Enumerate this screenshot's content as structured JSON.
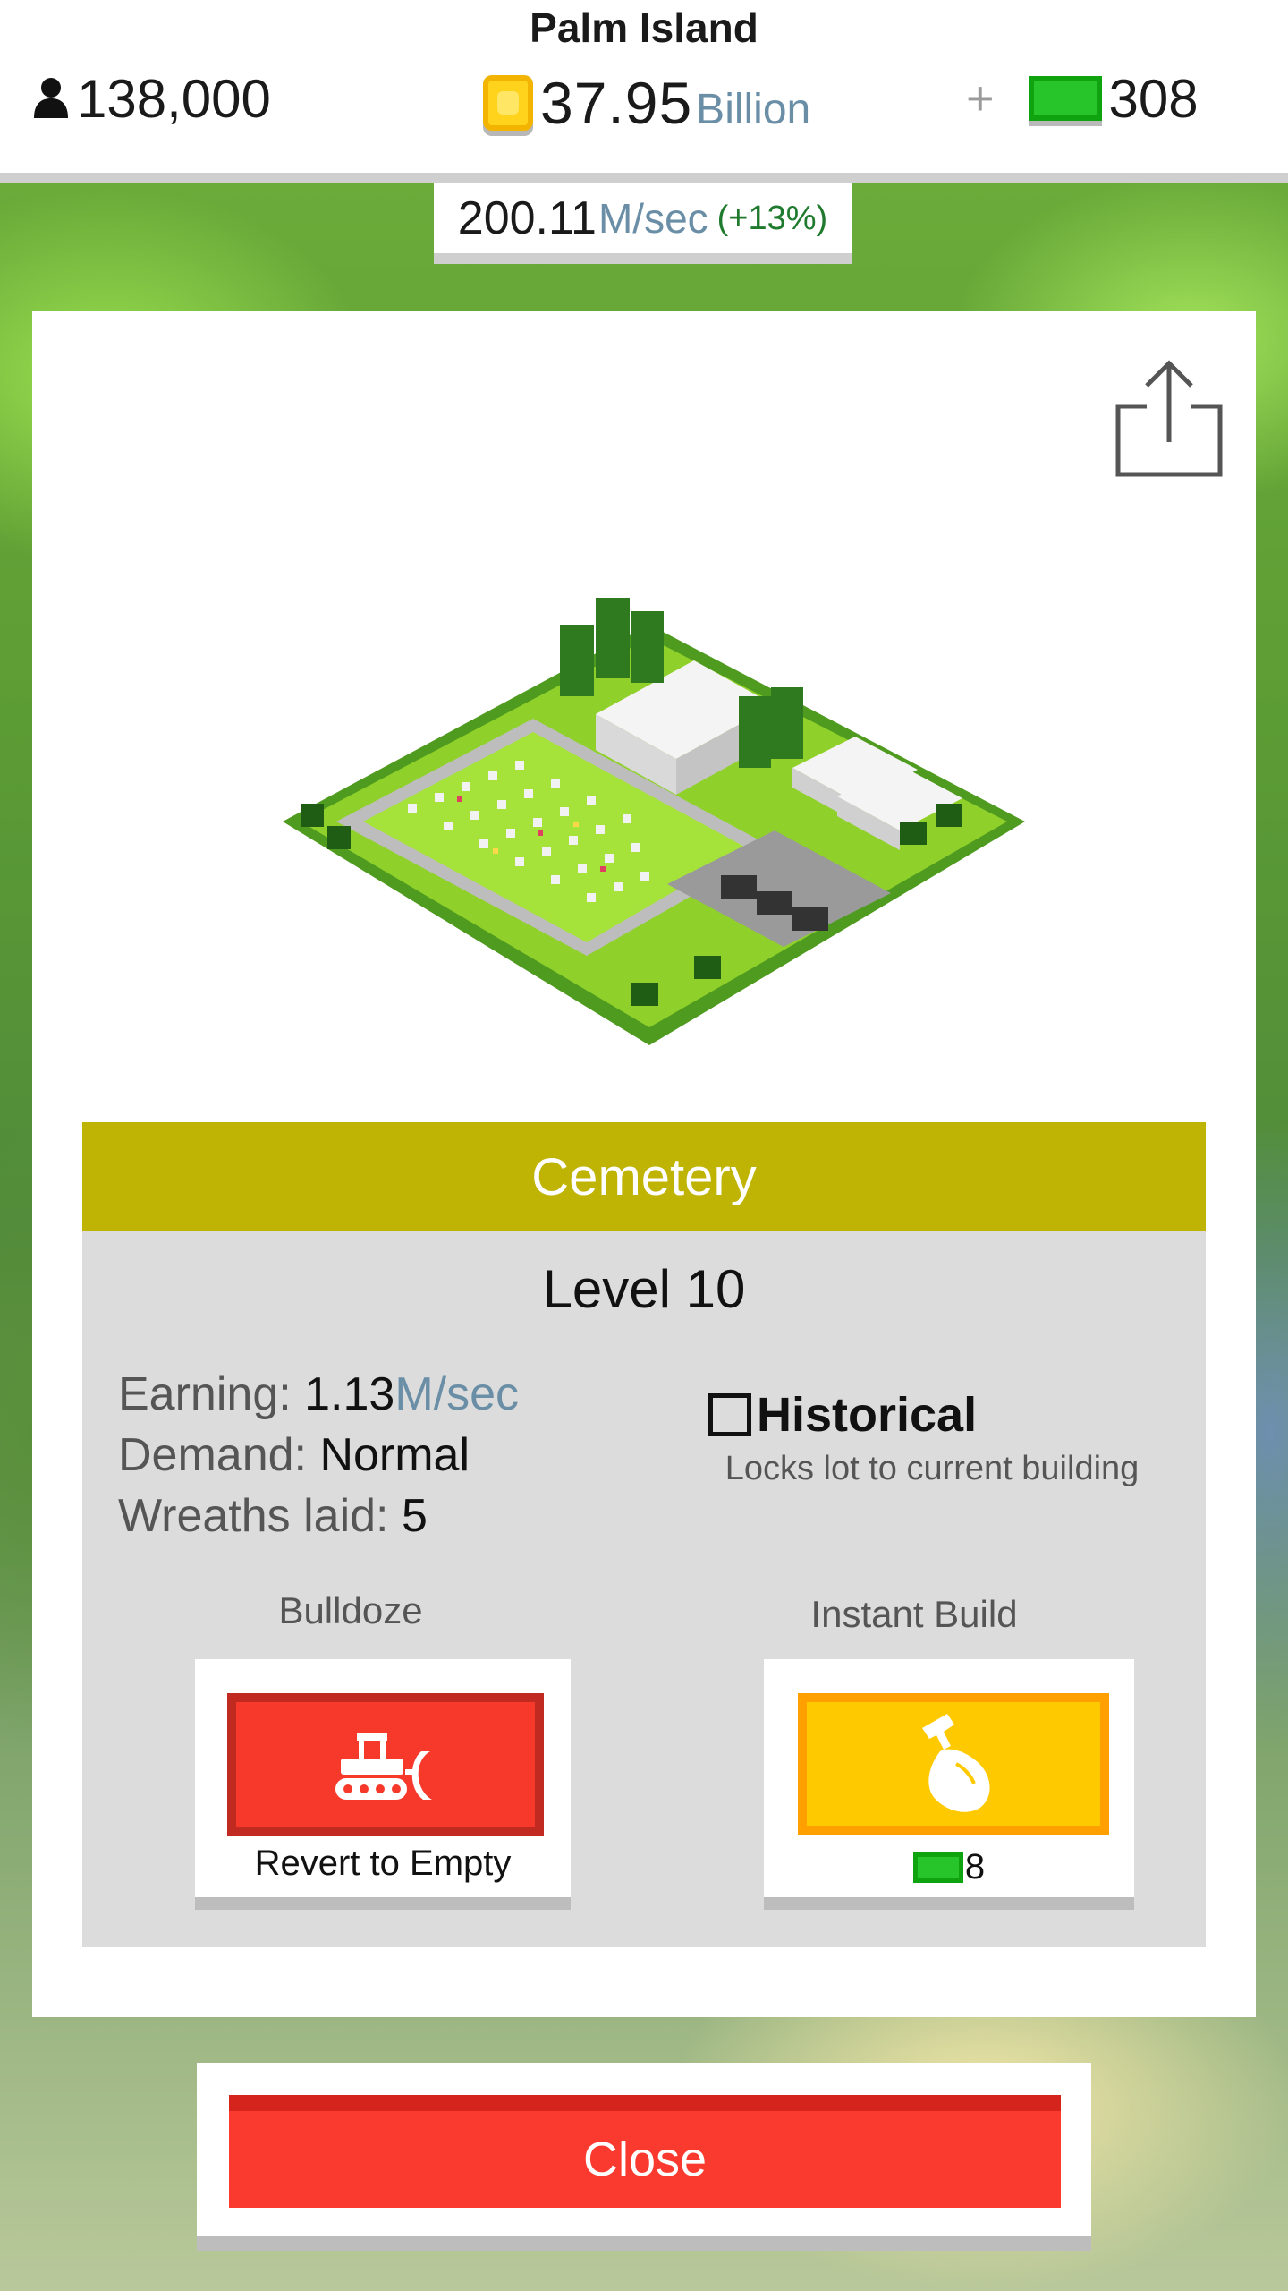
{
  "header": {
    "island_name": "Palm Island",
    "population": "138,000",
    "coins_value": "37.95",
    "coins_unit": "Billion",
    "add_label": "+",
    "cash": "308",
    "income_rate": "200.11",
    "income_unit": "M/sec",
    "income_bonus": "(+13%)"
  },
  "building": {
    "name": "Cemetery",
    "level": "Level 10",
    "earning_label": "Earning:",
    "earning_value": "1.13",
    "earning_unit": "M/sec",
    "demand_label": "Demand:",
    "demand_value": "Normal",
    "wreaths_label": "Wreaths laid:",
    "wreaths_value": "5"
  },
  "historical": {
    "label": "Historical",
    "checked": false,
    "description": "Locks lot to current building"
  },
  "actions": {
    "bulldoze_title": "Bulldoze",
    "bulldoze_caption": "Revert to Empty",
    "instant_title": "Instant Build",
    "instant_cost": "8"
  },
  "close_label": "Close",
  "colors": {
    "name_bar": "#bfb304",
    "bulldoze": "#f7392b",
    "instant": "#ffc900",
    "close": "#fa3a2e",
    "cash_green": "#27c42a",
    "coin_gold": "#ffd21c"
  },
  "icons": [
    "person-icon",
    "coin-icon",
    "cash-icon",
    "share-icon",
    "bulldozer-icon",
    "hammer-hand-icon"
  ]
}
